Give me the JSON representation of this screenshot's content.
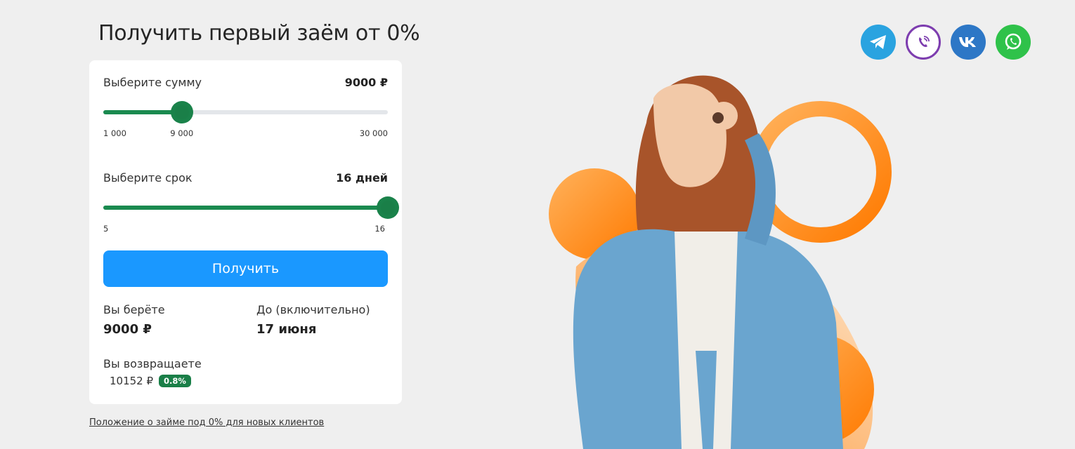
{
  "page": {
    "title": "Получить первый заём от 0%"
  },
  "amount": {
    "label": "Выберите сумму",
    "value": "9000 ₽",
    "min_label": "1 000",
    "current_label": "9 000",
    "max_label": "30 000",
    "min": 1000,
    "max": 30000,
    "current": 9000
  },
  "term": {
    "label": "Выберите срок",
    "value": "16 дней",
    "min_label": "5",
    "max_label": "16",
    "min": 5,
    "max": 16,
    "current": 16
  },
  "submit": {
    "label": "Получить"
  },
  "summary": {
    "take_label": "Вы берёте",
    "take_value": "9000 ₽",
    "until_label": "До (включительно)",
    "until_value": "17 июня",
    "return_label": "Вы возвращаете",
    "return_value": "10152 ₽",
    "rate_badge": "0.8%"
  },
  "terms_link": "Положение о займе под 0% для новых клиентов",
  "socials": [
    {
      "name": "telegram-icon",
      "color": "#2aa3e0"
    },
    {
      "name": "viber-icon",
      "color": "#7d3daf"
    },
    {
      "name": "vk-icon",
      "color": "#2d77c6"
    },
    {
      "name": "whatsapp-icon",
      "color": "#2fc24a"
    }
  ],
  "colors": {
    "accent": "#1a98ff",
    "slider": "#1a8a4f",
    "orange": "#ff8a1c"
  }
}
